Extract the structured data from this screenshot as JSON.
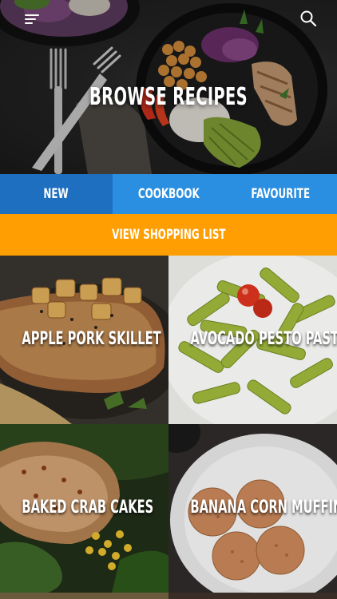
{
  "header": {
    "title": "BROWSE RECIPES",
    "menu_icon": "menu-icon",
    "search_icon": "search-icon"
  },
  "tabs": [
    {
      "label": "NEW",
      "active": true
    },
    {
      "label": "COOKBOOK",
      "active": false
    },
    {
      "label": "FAVOURITE",
      "active": false
    }
  ],
  "shopping": {
    "label": "VIEW SHOPPING LIST"
  },
  "recipes": [
    {
      "title": "APPLE PORK SKILLET"
    },
    {
      "title": "AVOCADO PESTO PASTA"
    },
    {
      "title": "BAKED CRAB CAKES"
    },
    {
      "title": "BANANA CORN MUFFINS"
    }
  ],
  "colors": {
    "tab_bar": "#2a8fe0",
    "tab_active": "#1f6fc1",
    "shopping_bar": "#ff9e02",
    "text": "#ffffff"
  }
}
